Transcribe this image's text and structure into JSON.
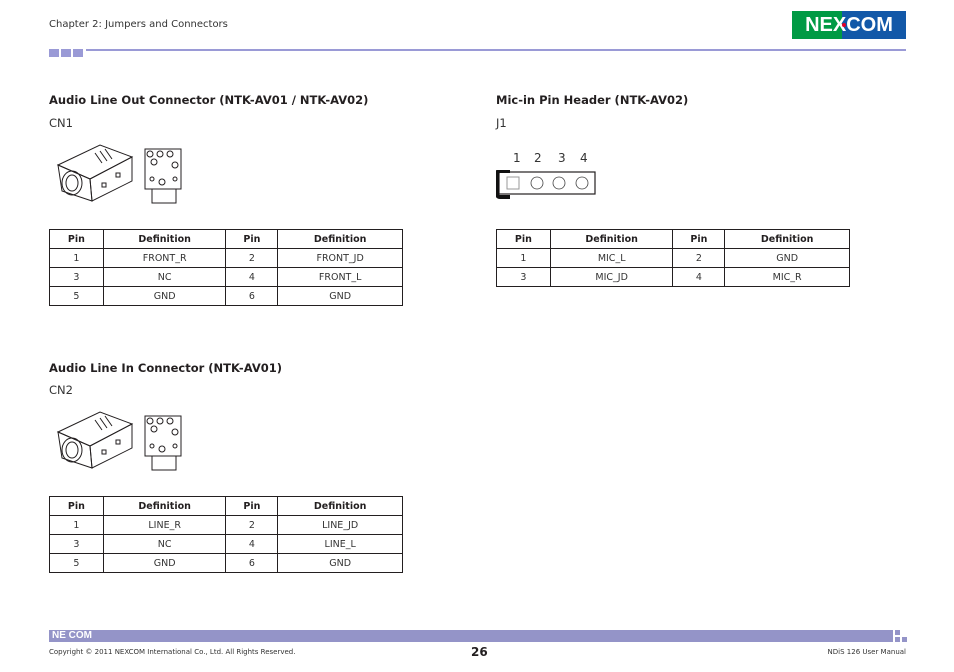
{
  "header": {
    "chapter": "Chapter 2: Jumpers and Connectors",
    "logo_text": "NEXCOM",
    "colors": {
      "accent": "#9a9ad6",
      "logo_green": "#009a44",
      "logo_blue": "#1258a8",
      "logo_red": "#e4002b"
    }
  },
  "sections": {
    "line_out": {
      "title": "Audio Line Out Connector (NTK-AV01 / NTK-AV02)",
      "ref": "CN1",
      "diagram": "audio-jack-drawing",
      "table": {
        "headers": [
          "Pin",
          "Definition",
          "Pin",
          "Definition"
        ],
        "rows": [
          [
            "1",
            "FRONT_R",
            "2",
            "FRONT_JD"
          ],
          [
            "3",
            "NC",
            "4",
            "FRONT_L"
          ],
          [
            "5",
            "GND",
            "6",
            "GND"
          ]
        ]
      }
    },
    "mic_in": {
      "title": "Mic-in Pin Header (NTK-AV02)",
      "ref": "J1",
      "pin_labels": [
        "1",
        "2",
        "3",
        "4"
      ],
      "table": {
        "headers": [
          "Pin",
          "Definition",
          "Pin",
          "Definition"
        ],
        "rows": [
          [
            "1",
            "MIC_L",
            "2",
            "GND"
          ],
          [
            "3",
            "MIC_JD",
            "4",
            "MIC_R"
          ]
        ]
      }
    },
    "line_in": {
      "title": "Audio Line In Connector (NTK-AV01)",
      "ref": "CN2",
      "diagram": "audio-jack-drawing",
      "table": {
        "headers": [
          "Pin",
          "Definition",
          "Pin",
          "Definition"
        ],
        "rows": [
          [
            "1",
            "LINE_R",
            "2",
            "LINE_JD"
          ],
          [
            "3",
            "NC",
            "4",
            "LINE_L"
          ],
          [
            "5",
            "GND",
            "6",
            "GND"
          ]
        ]
      }
    }
  },
  "footer": {
    "logo_text": "NE COM",
    "copyright": "Copyright © 2011 NEXCOM International Co., Ltd. All Rights Reserved.",
    "page_number": "26",
    "manual": "NDiS 126 User Manual"
  }
}
